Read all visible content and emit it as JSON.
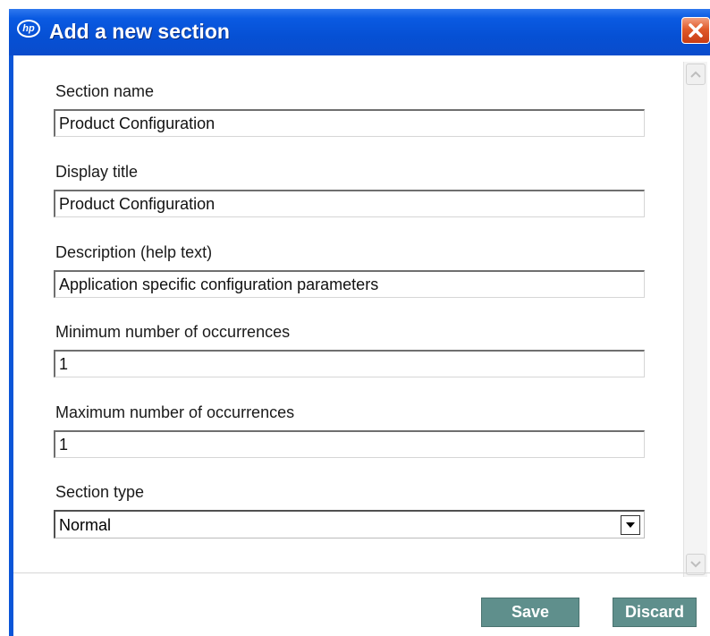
{
  "window": {
    "title": "Add a new section",
    "logo_text": "hp",
    "close_icon": "close-icon"
  },
  "form": {
    "section_name": {
      "label": "Section name",
      "value": "Product Configuration"
    },
    "display_title": {
      "label": "Display title",
      "value": "Product Configuration"
    },
    "description": {
      "label": "Description (help text)",
      "value": "Application specific configuration parameters"
    },
    "min_occurrences": {
      "label": "Minimum number of occurrences",
      "value": "1"
    },
    "max_occurrences": {
      "label": "Maximum number of occurrences",
      "value": "1"
    },
    "section_type": {
      "label": "Section type",
      "value": "Normal"
    }
  },
  "buttons": {
    "save": "Save",
    "discard": "Discard"
  },
  "colors": {
    "titlebar": "#0a50d4",
    "close": "#e05a2a",
    "button": "#5f8f8c"
  }
}
